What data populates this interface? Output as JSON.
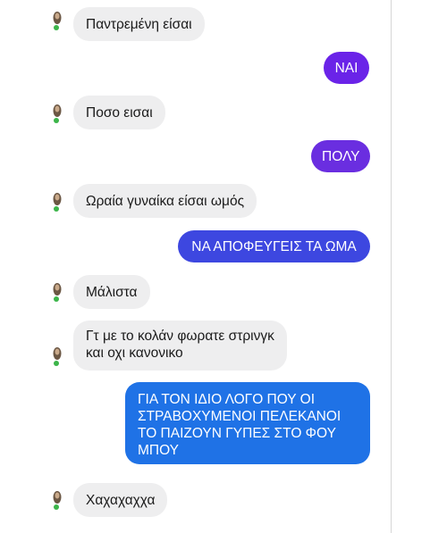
{
  "messages": [
    {
      "side": "in",
      "text": "Παντρεμένη είσαι"
    },
    {
      "side": "out",
      "text": "ΝΑΙ",
      "color": "#6a23e8"
    },
    {
      "side": "in",
      "text": "Ποσο εισαι"
    },
    {
      "side": "out",
      "text": "ΠΟΛΥ",
      "color": "#6a2ee0"
    },
    {
      "side": "in",
      "text": "Ωραία γυναίκα είσαι ωμός"
    },
    {
      "side": "out",
      "text": "ΝΑ ΑΠΟΦΕΥΓΕΙΣ ΤΑ ΩΜΑ",
      "color": "#3d47e0"
    },
    {
      "side": "in",
      "text": "Μάλιστα"
    },
    {
      "side": "in",
      "text": "Γτ με το κολάν φωρατε στρινγκ\nκαι οχι κανονικο"
    },
    {
      "side": "out",
      "text": "ΓΙΑ ΤΟΝ ΙΔΙΟ ΛΟΓΟ ΠΟΥ ΟΙ\nΣΤΡΑΒΟΧΥΜΕΝΟΙ ΠΕΛΕΚΑΝΟΙ\nΤΟ ΠΑΙΖΟΥΝ ΓΥΠΕΣ ΣΤΟ ΦΟΥ\nΜΠΟΥ",
      "color": "#1f72e6"
    },
    {
      "side": "in",
      "text": "Χαχαχαχχα"
    }
  ],
  "avatar_icon": "user-avatar-icon",
  "colors": {
    "incoming_bubble": "#eeeeef",
    "incoming_text": "#1a1a1a",
    "online_dot": "#3cb54a"
  }
}
